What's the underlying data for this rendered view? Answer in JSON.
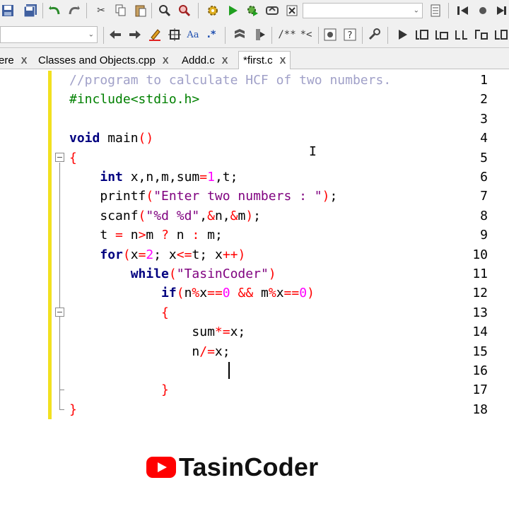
{
  "toolbar": {
    "search_combo_value": "",
    "scope_combo_value": "",
    "comment_label": "/**",
    "uncomment_label": "*<",
    "regex_label": ".*",
    "case_label": "Aa"
  },
  "tabs": [
    {
      "label": "ere",
      "active": false
    },
    {
      "label": "Classes and Objects.cpp",
      "active": false
    },
    {
      "label": "Addd.c",
      "active": false
    },
    {
      "label": "*first.c",
      "active": true
    }
  ],
  "close_glyph": "X",
  "editor": {
    "line_numbers": [
      "1",
      "2",
      "3",
      "4",
      "5",
      "6",
      "7",
      "8",
      "9",
      "10",
      "11",
      "12",
      "13",
      "14",
      "15",
      "16",
      "17",
      "18"
    ],
    "lines": [
      "//program to calculate HCF of two numbers.",
      "#include<stdio.h>",
      "",
      "void main()",
      "{",
      "    int x,n,m,sum=1,t;",
      "    printf(\"Enter two numbers : \");",
      "    scanf(\"%d %d\",&n,&m);",
      "    t = n>m ? n : m;",
      "    for(x=2; x<=t; x++)",
      "        while(\"TasinCoder\")",
      "            if(n%x==0 && m%x==0)",
      "            {",
      "                sum*=x;",
      "                n/=x;",
      "                ",
      "            }",
      "}"
    ]
  },
  "watermark": {
    "text": "TasinCoder",
    "logo": "youtube-logo"
  },
  "colors": {
    "change_bar": "#f2e020",
    "keyword": "#000080",
    "comment": "#a0a0c8",
    "preprocessor": "#008000",
    "string": "#7f007f",
    "number": "#ff00ff",
    "operator": "#ff0000",
    "brand_red": "#ff0000"
  }
}
